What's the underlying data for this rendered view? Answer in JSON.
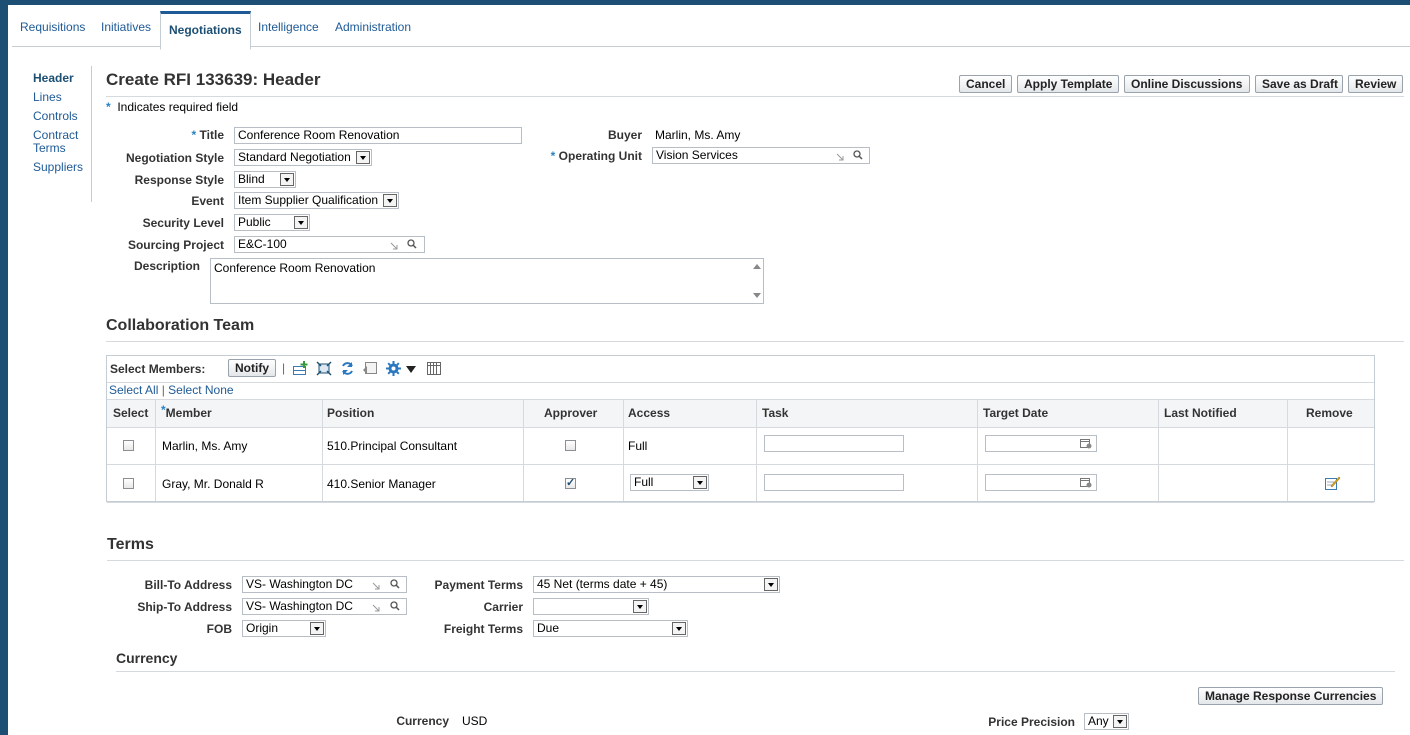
{
  "tabs": [
    "Requisitions",
    "Initiatives",
    "Negotiations",
    "Intelligence",
    "Administration"
  ],
  "active_tab": "Negotiations",
  "sidenav": [
    "Header",
    "Lines",
    "Controls",
    "Contract",
    "Terms",
    "Suppliers"
  ],
  "page_title": "Create RFI 133639: Header",
  "buttons": {
    "cancel": "Cancel",
    "apply_template": "Apply Template",
    "online_discussions": "Online Discussions",
    "save_as_draft": "Save as Draft",
    "review": "Review"
  },
  "required_note": "Indicates required field",
  "required_star": "*",
  "header_fields": {
    "title_label": "Title",
    "title_value": "Conference Room Renovation",
    "negotiation_style_label": "Negotiation Style",
    "negotiation_style_value": "Standard Negotiation",
    "response_style_label": "Response Style",
    "response_style_value": "Blind",
    "event_label": "Event",
    "event_value": "Item Supplier Qualification",
    "security_level_label": "Security Level",
    "security_level_value": "Public",
    "sourcing_project_label": "Sourcing Project",
    "sourcing_project_value": "E&C-100",
    "description_label": "Description",
    "description_value": "Conference Room Renovation",
    "buyer_label": "Buyer",
    "buyer_value": "Marlin, Ms. Amy",
    "operating_unit_label": "Operating Unit",
    "operating_unit_value": "Vision Services"
  },
  "collab": {
    "title": "Collaboration Team",
    "select_members": "Select Members:",
    "notify": "Notify",
    "toolbar_sep": "|",
    "select_all": "Select All",
    "select_sep": "|",
    "select_none": "Select None",
    "columns": [
      "Select",
      "Member",
      "Position",
      "Approver",
      "Access",
      "Task",
      "Target Date",
      "Last Notified",
      "Remove"
    ],
    "rows": [
      {
        "member": "Marlin, Ms. Amy",
        "position": "510.Principal Consultant",
        "approver": false,
        "access": "Full"
      },
      {
        "member": "Gray, Mr. Donald R",
        "position": "410.Senior Manager",
        "approver": true,
        "access": "Full"
      }
    ]
  },
  "terms": {
    "title": "Terms",
    "bill_to_label": "Bill-To Address",
    "bill_to_value": "VS- Washington DC",
    "ship_to_label": "Ship-To Address",
    "ship_to_value": "VS- Washington DC",
    "fob_label": "FOB",
    "fob_value": "Origin",
    "payment_terms_label": "Payment Terms",
    "payment_terms_value": "45 Net (terms date + 45)",
    "carrier_label": "Carrier",
    "carrier_value": "",
    "freight_terms_label": "Freight Terms",
    "freight_terms_value": "Due"
  },
  "currency": {
    "title": "Currency",
    "manage_button": "Manage Response Currencies",
    "currency_label": "Currency",
    "currency_value": "USD",
    "price_precision_label": "Price Precision",
    "price_precision_value": "Any"
  },
  "colors": {
    "brand": "#1c4f73",
    "link": "#1e5a96",
    "required_star": "#2b82c3"
  }
}
